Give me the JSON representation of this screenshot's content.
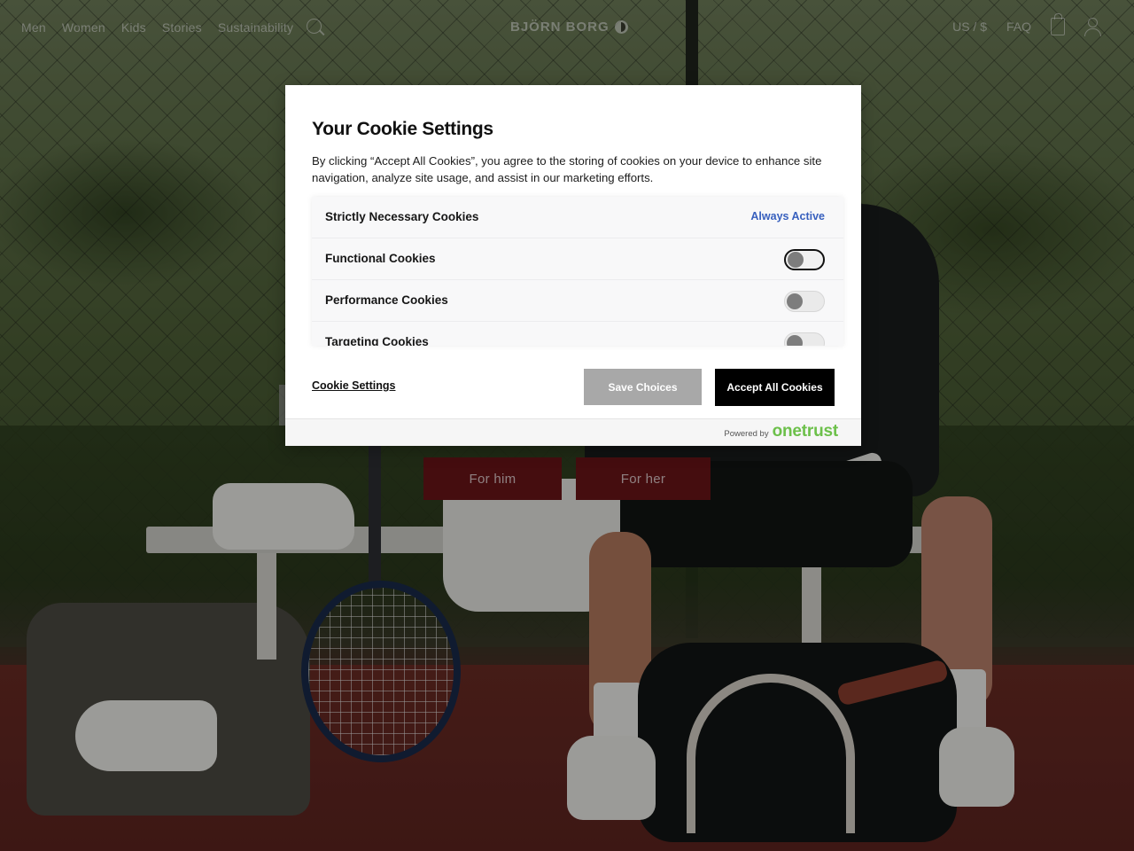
{
  "header": {
    "nav_left": [
      "Men",
      "Women",
      "Kids",
      "Stories",
      "Sustainability"
    ],
    "brand": "BJÖRN BORG",
    "region": "US / $",
    "faq": "FAQ"
  },
  "icons": {
    "search": "search-icon",
    "logo_mark": "brand-logo-icon",
    "bag": "shopping-bag-icon",
    "account": "user-icon"
  },
  "hero": {
    "cta_him": "For him",
    "cta_her": "For her",
    "cta_color": "#6b1418"
  },
  "cookie_modal": {
    "title": "Your Cookie Settings",
    "description": "By clicking “Accept All Cookies”, you agree to the storing of cookies on your device to enhance site navigation, analyze site usage, and assist in our marketing efforts.",
    "categories": [
      {
        "label": "Strictly Necessary Cookies",
        "status": "Always Active",
        "enabled": true
      },
      {
        "label": "Functional Cookies",
        "enabled": false
      },
      {
        "label": "Performance Cookies",
        "enabled": false
      },
      {
        "label": "Targeting Cookies",
        "enabled": false
      }
    ],
    "cookie_settings_link": "Cookie Settings",
    "save_label": "Save Choices",
    "accept_label": "Accept All Cookies",
    "powered_by": "Powered by",
    "vendor": "onetrust",
    "accent_color": "#3860be",
    "vendor_color": "#6cc04a"
  }
}
